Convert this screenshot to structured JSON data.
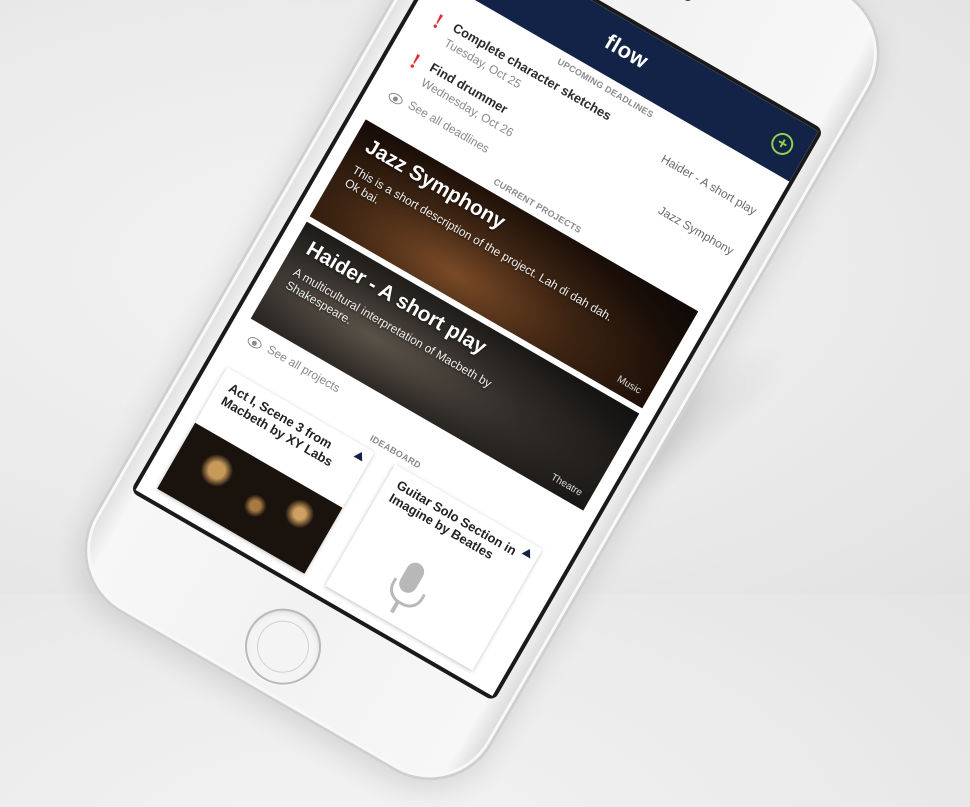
{
  "app": {
    "title": "flow",
    "add_symbol": "+"
  },
  "deadlines": {
    "section_title": "UPCOMING DEADLINES",
    "items": [
      {
        "alert": "!",
        "title": "Complete character sketches",
        "date": "Tuesday, Oct 25",
        "project": "Haider - A short play"
      },
      {
        "alert": "!",
        "title": "Find drummer",
        "date": "Wednesday, Oct 26",
        "project": "Jazz Symphony"
      }
    ],
    "see_all": "See all deadlines"
  },
  "projects": {
    "section_title": "CURRENT PROJECTS",
    "items": [
      {
        "title": "Jazz Symphony",
        "description": "This is a short description of the project. Lah di dah dah. Ok bai.",
        "tag": "Music"
      },
      {
        "title": "Haider - A short play",
        "description": "A multicultural interpretation of Macbeth by Shakespeare.",
        "tag": "Theatre"
      }
    ],
    "see_all": "See all projects"
  },
  "ideaboard": {
    "section_title": "IDEABOARD",
    "items": [
      {
        "title": "Act I, Scene 3 from Macbeth by XY Labs",
        "icon": "photo"
      },
      {
        "title": "Guitar Solo Section in Imagine by Beatles",
        "icon": "microphone-icon"
      }
    ]
  },
  "colors": {
    "navbar": "#132247",
    "alert": "#e23232",
    "add": "#8fd14f"
  }
}
